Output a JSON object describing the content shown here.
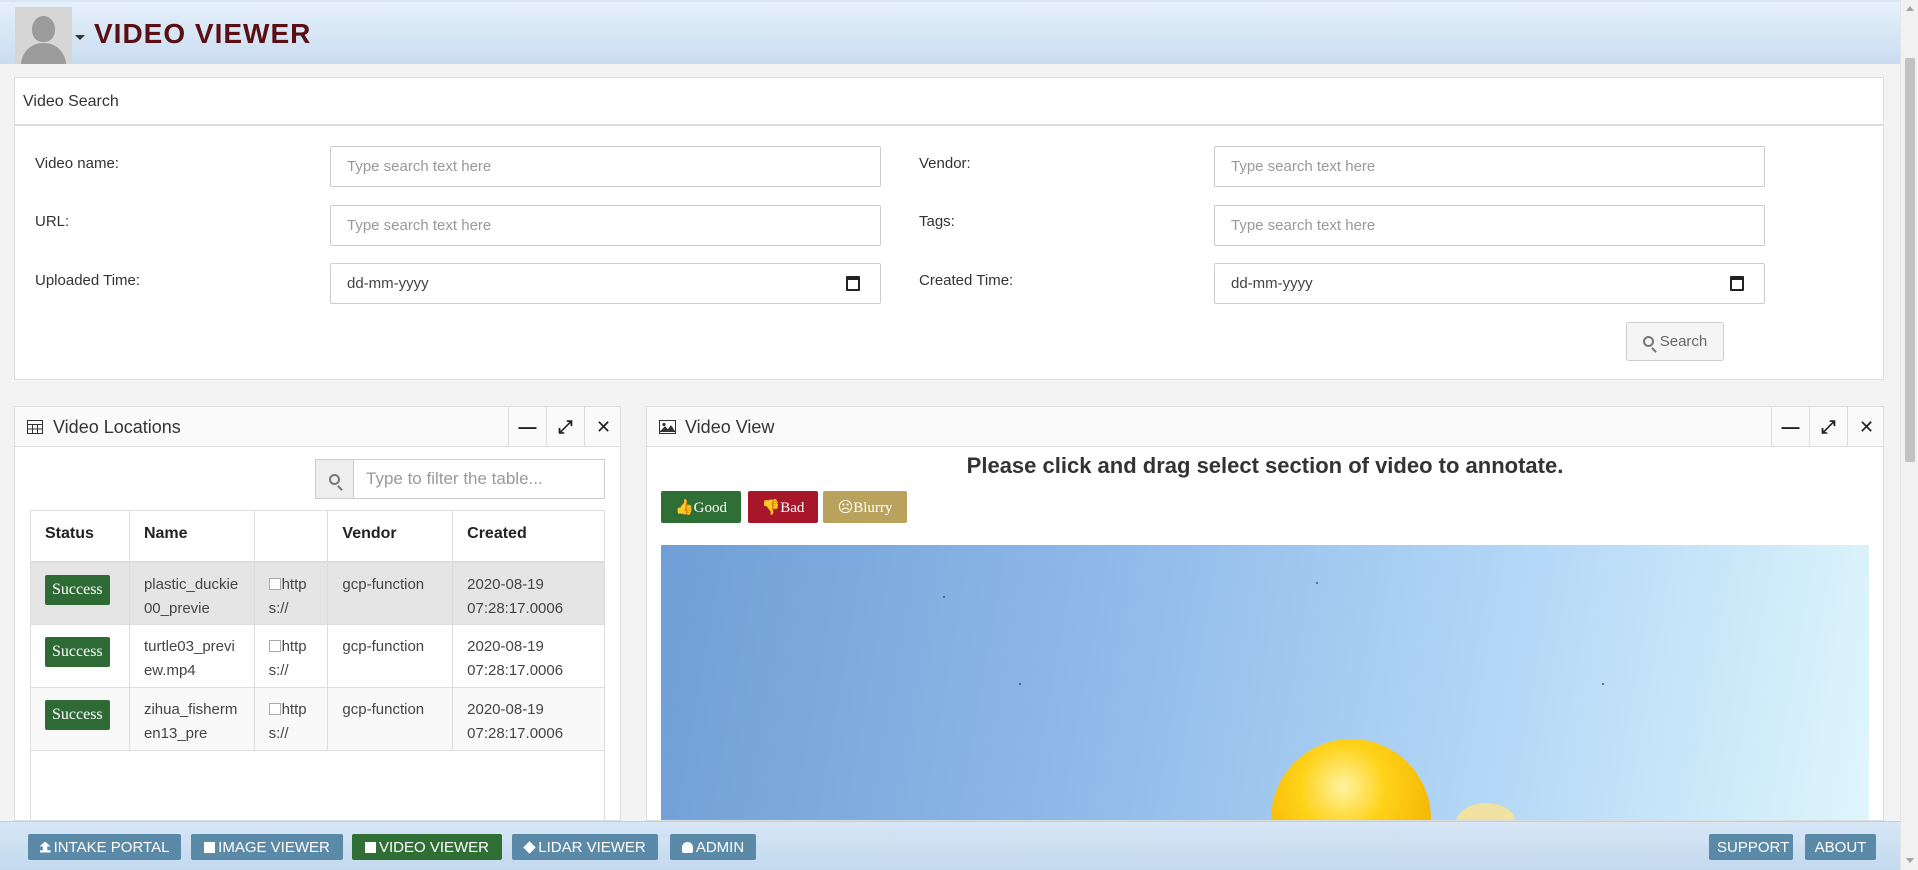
{
  "header": {
    "title": "VIDEO VIEWER"
  },
  "search": {
    "title": "Video Search",
    "video_name_label": "Video name:",
    "vendor_label": "Vendor:",
    "url_label": "URL:",
    "tags_label": "Tags:",
    "uploaded_label": "Uploaded Time:",
    "created_label": "Created Time:",
    "placeholder": "Type search text here",
    "date_placeholder": "dd-mm-yyyy",
    "button_label": "Search"
  },
  "locations": {
    "title": "Video Locations",
    "filter_placeholder": "Type to filter the table...",
    "columns": [
      "Status",
      "Name",
      "",
      "Vendor",
      "Created"
    ],
    "rows": [
      {
        "status": "Success",
        "name": "plastic_duckie00_previe",
        "url": "https://",
        "vendor": "gcp-function",
        "created": "2020-08-19 07:28:17.0006"
      },
      {
        "status": "Success",
        "name": "turtle03_preview.mp4",
        "url": "https://",
        "vendor": "gcp-function",
        "created": "2020-08-19 07:28:17.0006"
      },
      {
        "status": "Success",
        "name": "zihua_fishermen13_pre",
        "url": "https://",
        "vendor": "gcp-function",
        "created": "2020-08-19 07:28:17.0006"
      }
    ]
  },
  "video_view": {
    "title": "Video View",
    "instruction": "Please click and drag select section of video to annotate.",
    "good_label": "Good",
    "bad_label": "Bad",
    "blurry_label": "Blurry",
    "colors": {
      "good": "#2f6e35",
      "bad": "#a8162a",
      "blurry": "#b9a35c"
    }
  },
  "footer": {
    "intake_portal": "INTAKE PORTAL",
    "image_viewer": "IMAGE VIEWER",
    "video_viewer": "VIDEO VIEWER",
    "lidar_viewer": "LIDAR VIEWER",
    "admin": "ADMIN",
    "support": "SUPPORT",
    "about": "ABOUT"
  },
  "icons": [
    "user-avatar",
    "caret-down-icon",
    "calendar-icon",
    "search-icon",
    "table-icon",
    "image-icon",
    "minimize-icon",
    "expand-icon",
    "close-icon",
    "thumbs-up-icon",
    "thumbs-down-icon",
    "frown-icon",
    "upload-icon",
    "file-video-icon",
    "cube-icon",
    "user-icon"
  ],
  "theme": {
    "brand": "#5a0f14",
    "success": "#2e6b34",
    "footer_button": "#5a8aa8"
  }
}
